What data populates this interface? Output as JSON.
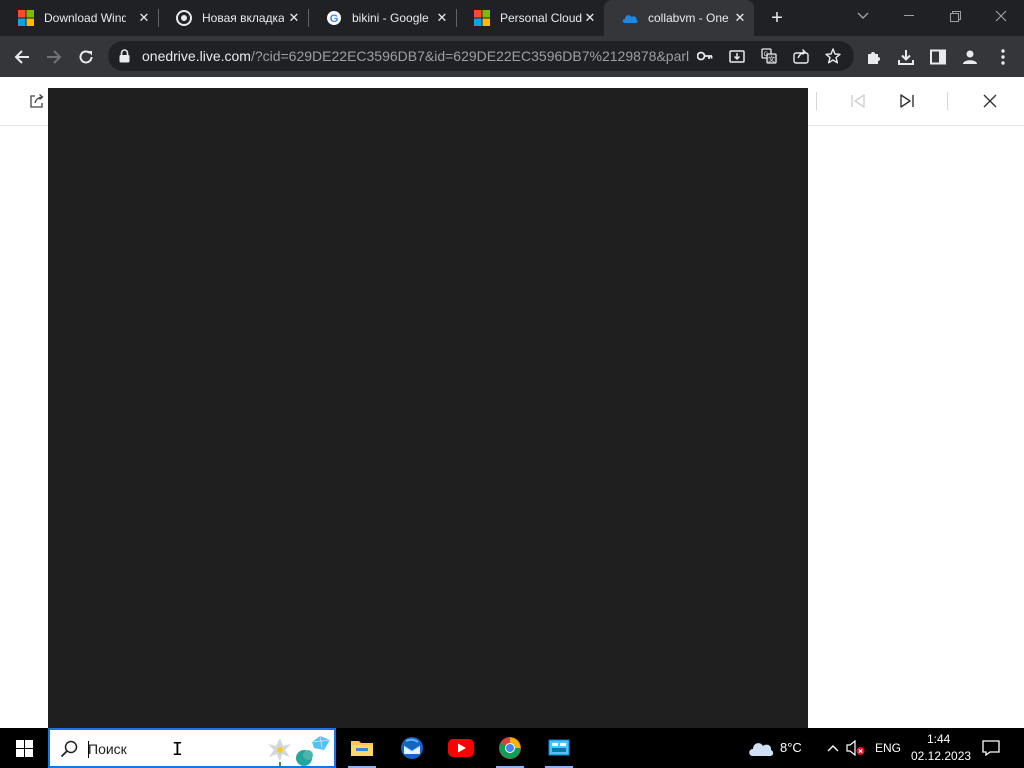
{
  "browser": {
    "tabs": [
      {
        "title": "Download Wind",
        "icon": "microsoft-logo-icon",
        "active": false
      },
      {
        "title": "Новая вкладка",
        "icon": "chrome-icon",
        "active": false
      },
      {
        "title": "bikini - Google",
        "icon": "google-icon",
        "active": false
      },
      {
        "title": "Personal Cloud",
        "icon": "microsoft-logo-icon",
        "active": false
      },
      {
        "title": "collabvm - One",
        "icon": "onedrive-icon",
        "active": true
      }
    ],
    "new_tab_label": "+",
    "url_host": "onedrive.live.com",
    "url_path": "/?cid=629DE22EC3596DB7&id=629DE22EC3596DB7%2129878&parl..."
  },
  "viewer": {
    "preview_background": "#1f1f1f"
  },
  "taskbar": {
    "search_placeholder": "Поиск",
    "weather_temp": "8°C",
    "language": "ENG",
    "time": "1:44",
    "date": "02.12.2023"
  },
  "colors": {
    "tab_strip": "#202124",
    "toolbar": "#35363a",
    "accent": "#1a73e8"
  }
}
